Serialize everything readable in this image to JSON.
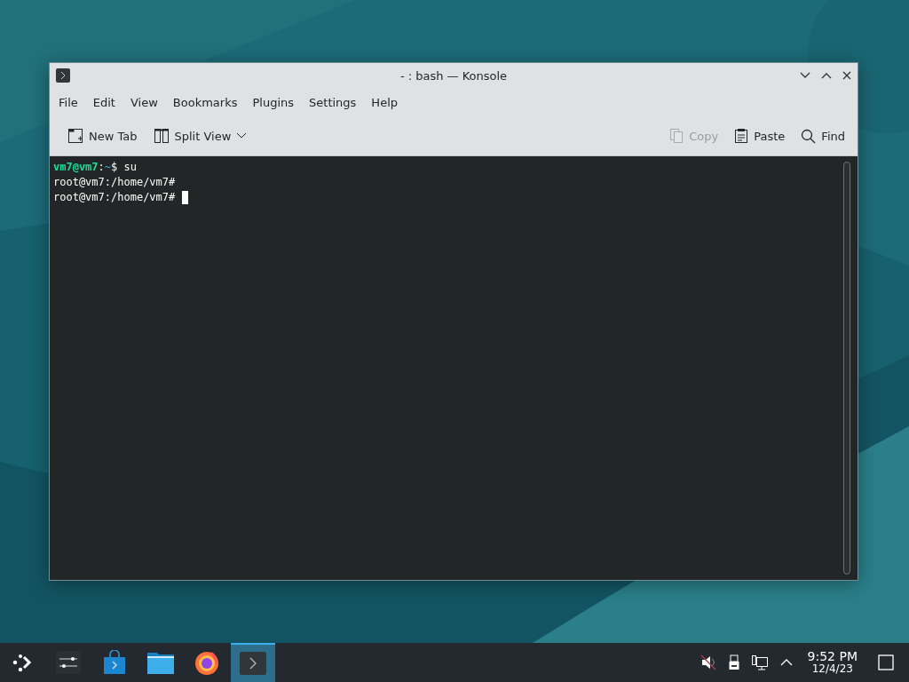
{
  "window": {
    "title": "- : bash — Konsole"
  },
  "menu": [
    "File",
    "Edit",
    "View",
    "Bookmarks",
    "Plugins",
    "Settings",
    "Help"
  ],
  "toolbar": {
    "left": [
      {
        "kind": "newtab",
        "label": "New Tab",
        "disabled": false
      },
      {
        "kind": "split",
        "label": "Split View",
        "disabled": false
      }
    ],
    "right": [
      {
        "kind": "copy",
        "label": "Copy",
        "disabled": true
      },
      {
        "kind": "paste",
        "label": "Paste",
        "disabled": false
      },
      {
        "kind": "find",
        "label": "Find",
        "disabled": false
      }
    ]
  },
  "terminal": {
    "lines": [
      {
        "segments": [
          {
            "kind": "user",
            "text": "vm7@vm7"
          },
          {
            "kind": "plain",
            "text": ":"
          },
          {
            "kind": "path",
            "text": "~"
          },
          {
            "kind": "plain",
            "text": "$ su"
          }
        ],
        "cursor": false
      },
      {
        "segments": [
          {
            "kind": "plain",
            "text": "root@vm7:/home/vm7#"
          }
        ],
        "cursor": false
      },
      {
        "segments": [
          {
            "kind": "plain",
            "text": "root@vm7:/home/vm7# "
          }
        ],
        "cursor": true
      }
    ]
  },
  "taskbar": {
    "items": [
      {
        "kind": "launcher",
        "selected": false
      },
      {
        "kind": "settings",
        "selected": false
      },
      {
        "kind": "store",
        "selected": false
      },
      {
        "kind": "files",
        "selected": false
      },
      {
        "kind": "browser",
        "selected": false
      },
      {
        "kind": "terminal",
        "selected": true
      }
    ],
    "tray": {
      "time": "9:52 PM",
      "date": "12/4/23"
    }
  }
}
